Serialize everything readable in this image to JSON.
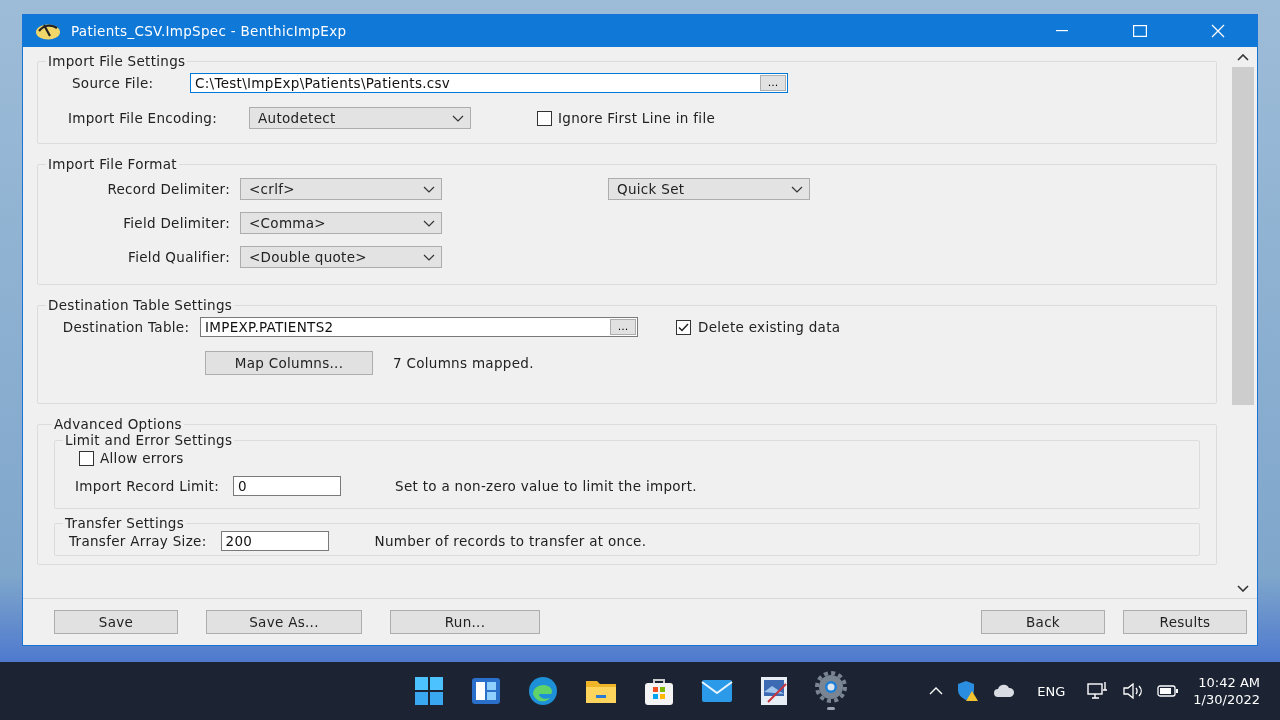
{
  "window": {
    "title": "Patients_CSV.ImpSpec - BenthicImpExp"
  },
  "import_file_settings": {
    "title": "Import File Settings",
    "source_file": {
      "label": "Source File:",
      "value": "C:\\Test\\ImpExp\\Patients\\Patients.csv",
      "browse": "..."
    },
    "encoding": {
      "label": "Import File Encoding:",
      "value": "Autodetect"
    },
    "ignore_first_line": {
      "label": "Ignore First Line in file",
      "checked": false
    }
  },
  "import_file_format": {
    "title": "Import File Format",
    "rows": [
      {
        "label": "Record Delimiter:",
        "value": "<crlf>"
      },
      {
        "label": "Field Delimiter:",
        "value": "<Comma>"
      },
      {
        "label": "Field Qualifier:",
        "value": "<Double quote>"
      }
    ],
    "quick_set": "Quick Set"
  },
  "destination_table_settings": {
    "title": "Destination Table Settings",
    "table": {
      "label": "Destination Table:",
      "value": "IMPEXP.PATIENTS2",
      "browse": "..."
    },
    "delete_existing": {
      "label": "Delete existing data",
      "checked": true
    },
    "map_button": "Map Columns...",
    "mapped_status": "7 Columns mapped."
  },
  "advanced_options": {
    "title": "Advanced Options",
    "limit": {
      "title": "Limit and Error Settings",
      "allow_errors": {
        "label": "Allow errors",
        "checked": false
      },
      "record_limit": {
        "label": "Import Record Limit:",
        "value": "0",
        "hint": "Set to a non-zero value to limit the import."
      }
    },
    "transfer": {
      "title": "Transfer Settings",
      "array_size": {
        "label": "Transfer Array Size:",
        "value": "200",
        "hint": "Number of records to transfer at once."
      }
    }
  },
  "buttons_left": [
    "Save",
    "Save As...",
    "Run..."
  ],
  "buttons_right": [
    "Back",
    "Results"
  ],
  "taskbar": {
    "language": "ENG",
    "time": "10:42 AM",
    "date": "1/30/2022"
  }
}
